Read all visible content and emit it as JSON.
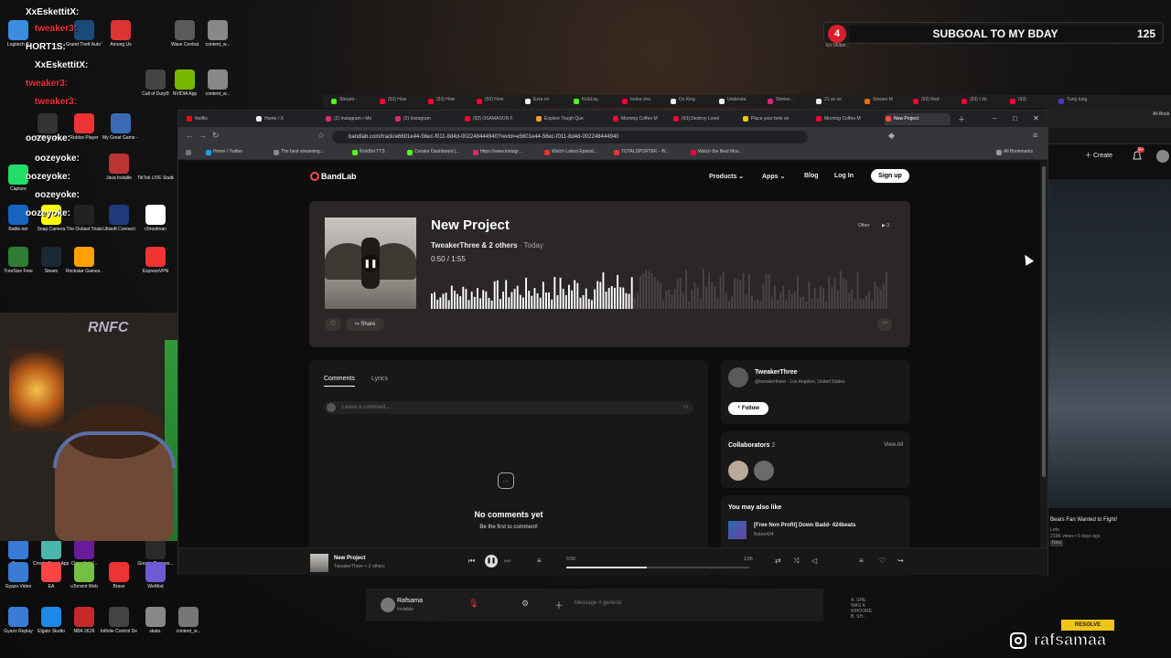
{
  "overlay": {
    "subgoal_count_badge": "4",
    "subgoal_label": "SUBGOAL TO MY BDAY",
    "subgoal_value": "125",
    "subgoal_sub": "En Ukiber...",
    "chat_names": [
      "XxEskettitX:",
      "tweaker3:",
      "HORT1S:",
      "XxEskettitX:",
      "tweaker3:",
      "tweaker3:",
      "oozeyoke:",
      "oozeyoke:",
      "oozeyoke:",
      "oozeyoke:",
      "oozeyoke:"
    ],
    "instagram_handle": "rafsamaa",
    "resolve_label": "RESOLVE",
    "webcam_sign": "RNFC"
  },
  "desktop_icons": [
    "Logitech G",
    "Grand Theft Auto V",
    "Among Us",
    "Wave Central",
    "content_w...",
    "Call of Duty®",
    "NVIDIA App",
    "content_w...",
    "OBS Studio",
    "Roblox Player",
    "My Great Game - My...",
    "Capture",
    "Java Installe",
    "TikTok LIVE Studio",
    "Battle.net",
    "Snap Camera",
    "The Outlast Trials",
    "Ubisoft Connect",
    "r2modman",
    "TreeSize Free",
    "Steam",
    "Rockstar Games...",
    "ExpressVPN",
    "Gyazo",
    "Create React App Sample",
    "ClownfishV...",
    "Google Passwo...",
    "Gyazo Video",
    "EA",
    "uTorrent Web",
    "Brave",
    "WeMod",
    "Gyazo Replay",
    "Elgato Studio",
    "NBA 2K26",
    "Infinite Control Deck.exe",
    "skate.",
    "content_w..."
  ],
  "back_window": {
    "tabs": [
      "Stream -",
      "(93) How",
      "(93) How",
      "(93) How",
      "Ezra on",
      "KickLay..",
      "broke cha",
      "Ox King",
      "Understa",
      "Stories -",
      "21 av on",
      "Stream M",
      "(93) Red",
      "(93) I do",
      "(93)",
      "Tung tung"
    ],
    "create_label": "Create",
    "notif_count": "9+",
    "all_bookmarks": "All Book",
    "video_title": "Bears Fan Wanted to Fight!",
    "video_channel": "Lofe",
    "video_meta": "219K views • 5 days ago",
    "video_badge": "New"
  },
  "browser": {
    "tabs": [
      {
        "label": "Netflix",
        "color": "#e50914"
      },
      {
        "label": "Home / X",
        "color": "#eeeeee"
      },
      {
        "label": "(2) Instagram • Me",
        "color": "#d62976"
      },
      {
        "label": "(2) Instagram",
        "color": "#d62976"
      },
      {
        "label": "(93) OSAMASON F",
        "color": "#ff0033"
      },
      {
        "label": "Explore Tough Que",
        "color": "#f0a030"
      },
      {
        "label": "Morning Coffee M",
        "color": "#ff0033"
      },
      {
        "label": "(93) Destroy Lonel",
        "color": "#ff0033"
      },
      {
        "label": "Place your bets on",
        "color": "#f0c419"
      },
      {
        "label": "Morning Coffee M",
        "color": "#ff0033"
      },
      {
        "label": "New Project",
        "color": "#f04e3e"
      }
    ],
    "url": "bandlab.com/track/e6601e44-56ec-f011-8d4d-002248444940?revId=e5601e44-56ec-f011-8d4d-002248444940",
    "bookmarks": [
      {
        "label": "Home / Twitter",
        "color": "#1da1f2"
      },
      {
        "label": "The best streaming...",
        "color": "#888888"
      },
      {
        "label": "KickBot TTS",
        "color": "#53fc18"
      },
      {
        "label": "Creator Dashboard |...",
        "color": "#53fc18"
      },
      {
        "label": "https://www.instagr...",
        "color": "#d62976"
      },
      {
        "label": "Watch Latest Episod...",
        "color": "#e33"
      },
      {
        "label": "TOTALSPORTEK - W...",
        "color": "#e33"
      },
      {
        "label": "Watch the Best Mov...",
        "color": "#ff0033"
      }
    ],
    "all_bookmarks": "All Bookmarks"
  },
  "bandlab": {
    "logo": "BandLab",
    "nav": {
      "products": "Products",
      "apps": "Apps",
      "blog": "Blog",
      "login": "Log In",
      "signup": "Sign up"
    },
    "track": {
      "title": "New Project",
      "artists": "TweakerThree & 2 others",
      "date": " · Today",
      "time": "0:50 / 1:55",
      "genre": "Other",
      "plays": "3",
      "share": "Share",
      "progress": 0.44
    },
    "comments": {
      "tab_comments": "Comments",
      "tab_lyrics": "Lyrics",
      "placeholder": "Leave a comment...",
      "empty_title": "No comments yet",
      "empty_sub": "Be the first to comment!"
    },
    "artist": {
      "name": "TweakerThree",
      "handle": "@tweakerthree",
      "location": "Los Angeles, United States",
      "follow": "Follow"
    },
    "collaborators": {
      "title": "Collaborators",
      "count": "2",
      "view_all": "View All"
    },
    "also_like": {
      "title": "You may also like",
      "track": "[Free Non Profit] Down Badd- 424beats",
      "artist": "Kobro424"
    },
    "player": {
      "title": "New Project",
      "artist": "TweakerThree + 2 others",
      "elapsed": "0:50",
      "total": "1:55",
      "progress": 0.44
    }
  },
  "discord": {
    "name": "Rafsama",
    "status": "Invisible",
    "message_placeholder": "Message #",
    "channel": "general",
    "chat_snippet": "A. SHE WAS A WHOORE. B, SH..."
  }
}
